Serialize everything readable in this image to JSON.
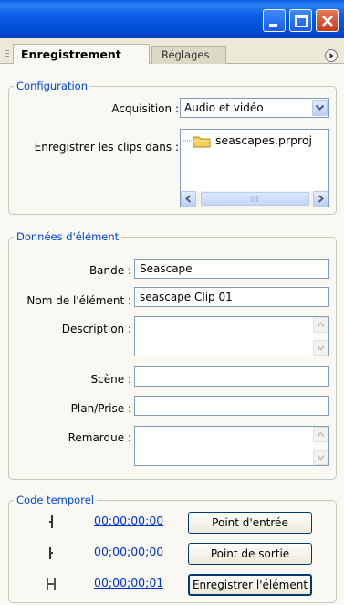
{
  "tabs": {
    "active": "Enregistrement",
    "inactive": "Réglages"
  },
  "configuration": {
    "legend": "Configuration",
    "acquisition_label": "Acquisition :",
    "acquisition_value": "Audio et vidéo",
    "save_label": "Enregistrer les clips dans :",
    "folder_item": "seascapes.prproj"
  },
  "element": {
    "legend": "Données d'élément",
    "bande_label": "Bande :",
    "bande_value": "Seascape",
    "nom_label": "Nom de l'élément :",
    "nom_value": "seascape Clip 01",
    "description_label": "Description :",
    "description_value": "",
    "scene_label": "Scène :",
    "scene_value": "",
    "plan_label": "Plan/Prise :",
    "plan_value": "",
    "remarque_label": "Remarque :",
    "remarque_value": ""
  },
  "timecode": {
    "legend": "Code temporel",
    "in_value": "00;00;00;00",
    "out_value": "00;00;00;00",
    "duration_value": "00;00;00;01",
    "in_button": "Point d'entrée",
    "out_button": "Point de sortie",
    "log_button": "Enregistrer l'élément"
  },
  "icons": {
    "minimize": "minimize-icon",
    "maximize": "maximize-icon",
    "close": "close-icon",
    "folder": "folder-icon",
    "panel_menu": "panel-menu-icon",
    "in_point": "in-point-icon",
    "out_point": "out-point-icon",
    "duration": "duration-icon"
  },
  "colors": {
    "titlebar": "#0149d1",
    "legend": "#0046d5",
    "timecode": "#0033cc",
    "close": "#c33c1c"
  }
}
